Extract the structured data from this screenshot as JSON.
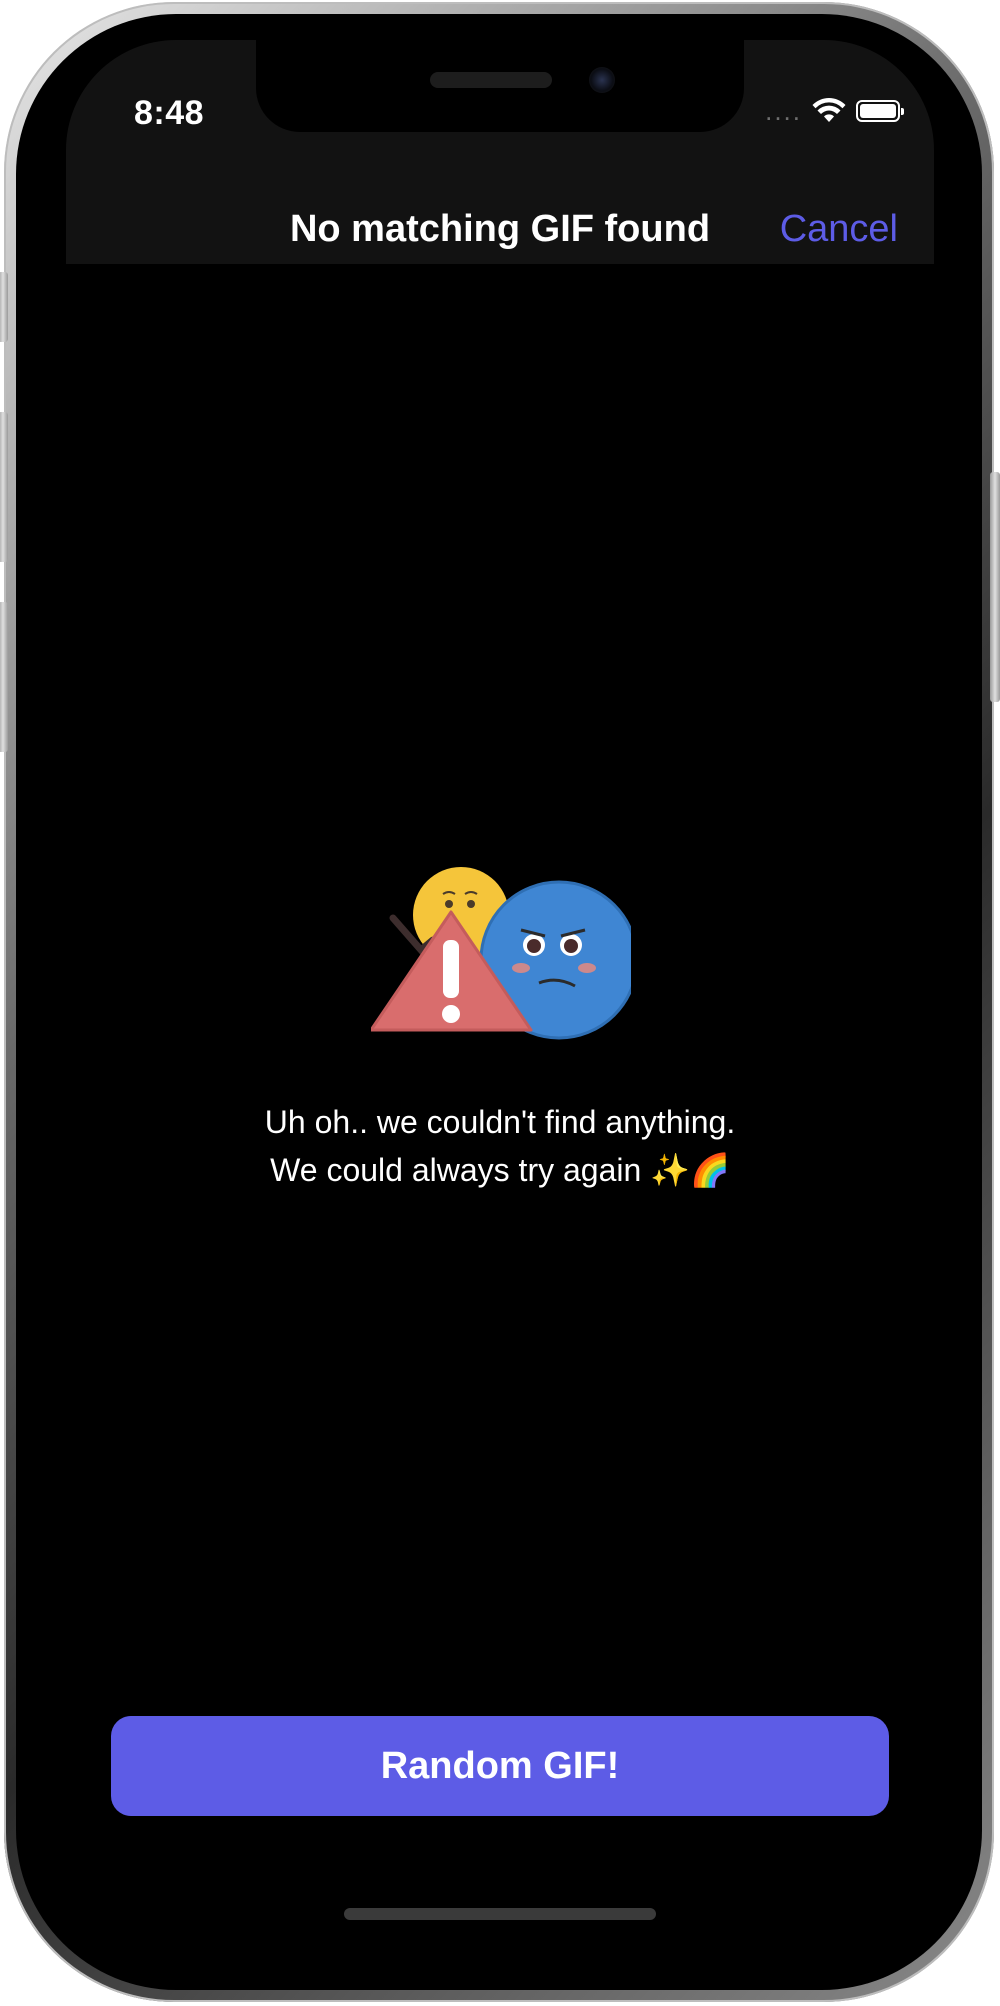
{
  "status_bar": {
    "time": "8:48",
    "signal_dots": "....",
    "icons": [
      "wifi-icon",
      "battery-icon"
    ]
  },
  "nav": {
    "title": "No matching GIF found",
    "cancel_label": "Cancel"
  },
  "empty_state": {
    "illustration": "error-emoji-illustration",
    "line1": "Uh oh.. we couldn't find anything.",
    "line2": "We could always try again ✨🌈"
  },
  "actions": {
    "random_label": "Random GIF!"
  },
  "colors": {
    "accent": "#5d5ce6",
    "background": "#000000",
    "navbar": "#121212"
  }
}
